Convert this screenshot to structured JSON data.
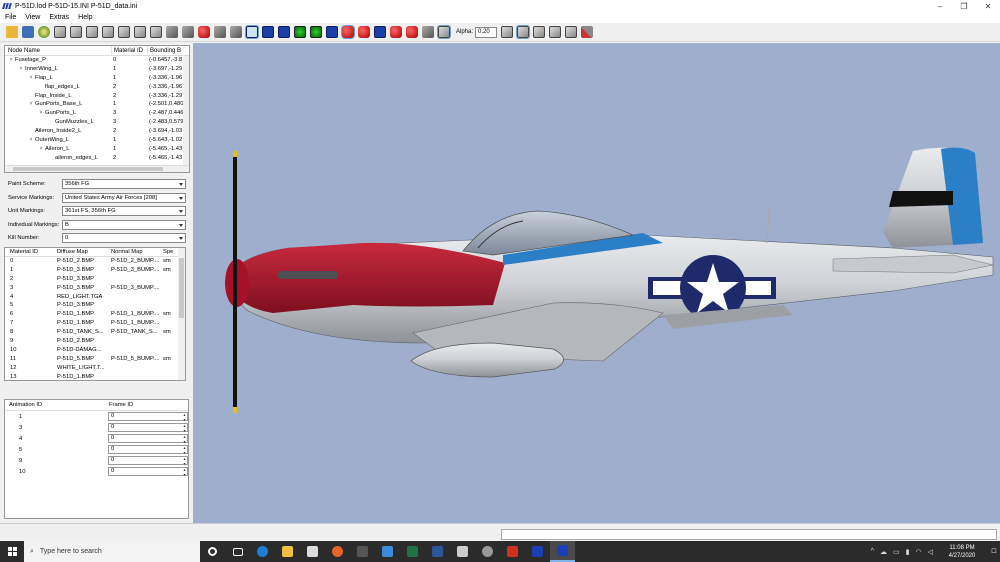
{
  "titlebar": {
    "title": "P-51D.lod  P-51D-15.INI  P-51D_data.ini",
    "minimize": "–",
    "maximize": "❐",
    "close": "✕"
  },
  "menu": [
    "File",
    "View",
    "Extras",
    "Help"
  ],
  "toolbar": {
    "alpha_label": "Alpha:",
    "alpha_value": "0.20"
  },
  "node_tree": {
    "headers": [
      "Node Name",
      "Material ID",
      "Bounding B"
    ],
    "rows": [
      {
        "indent": 0,
        "expand": "v",
        "name": "Fuselage_P",
        "mat": "0",
        "bounds": "(-0.6457,-3.8"
      },
      {
        "indent": 1,
        "expand": "v",
        "name": "InnerWing_L",
        "mat": "1",
        "bounds": "(-3.697,-1.29"
      },
      {
        "indent": 2,
        "expand": "v",
        "name": "Flap_L",
        "mat": "1",
        "bounds": "(-3.336,-1.96"
      },
      {
        "indent": 3,
        "expand": "",
        "name": "flap_edges_L",
        "mat": "2",
        "bounds": "(-3.336,-1.96"
      },
      {
        "indent": 2,
        "expand": "",
        "name": "Flap_Inside_L",
        "mat": "2",
        "bounds": "(-3.336,-1.29"
      },
      {
        "indent": 2,
        "expand": "v",
        "name": "GunPorts_Base_L",
        "mat": "1",
        "bounds": "(-2.501,0.480"
      },
      {
        "indent": 3,
        "expand": "v",
        "name": "GunPorts_L",
        "mat": "3",
        "bounds": "(-2.487,0.446"
      },
      {
        "indent": 4,
        "expand": "",
        "name": "GunMuzzles_L",
        "mat": "3",
        "bounds": "(-2.483,0.579"
      },
      {
        "indent": 2,
        "expand": "",
        "name": "Aileron_Inside2_L",
        "mat": "2",
        "bounds": "(-3.694,-1.03"
      },
      {
        "indent": 2,
        "expand": "v",
        "name": "OuterWing_L",
        "mat": "1",
        "bounds": "(-5.643,-1.02"
      },
      {
        "indent": 3,
        "expand": "v",
        "name": "Aileron_L",
        "mat": "1",
        "bounds": "(-5.465,-1.43"
      },
      {
        "indent": 4,
        "expand": "",
        "name": "aileron_edges_L",
        "mat": "2",
        "bounds": "(-5.465,-1.43"
      }
    ]
  },
  "fields": [
    {
      "label": "Paint Scheme:",
      "value": "356th FG"
    },
    {
      "label": "Service Markings:",
      "value": "United States Army Air Forces [208]"
    },
    {
      "label": "Unit Markings:",
      "value": "361st FS, 356th FG"
    },
    {
      "label": "Individual Markings:",
      "value": "B"
    },
    {
      "label": "Kill Number:",
      "value": "0"
    }
  ],
  "materials": {
    "headers": [
      "Material ID",
      "Diffuse Map",
      "Normal Map",
      "Spe"
    ],
    "rows": [
      [
        "0",
        "P-51D_2.BMP",
        "P-51D_2_BUMP....",
        "sm"
      ],
      [
        "1",
        "P-51D_3.BMP",
        "P-51D_3_BUMP....",
        "sm"
      ],
      [
        "2",
        "P-51D_3.BMP",
        "",
        ""
      ],
      [
        "3",
        "P-51D_3.BMP",
        "P-51D_3_BUMP....",
        ""
      ],
      [
        "4",
        "RED_LIGHT.TGA",
        "",
        ""
      ],
      [
        "5",
        "P-51D_3.BMP",
        "",
        ""
      ],
      [
        "6",
        "P-51D_1.BMP",
        "P-51D_1_BUMP....",
        "sm"
      ],
      [
        "7",
        "P-51D_1.BMP",
        "P-51D_1_BUMP....",
        ""
      ],
      [
        "8",
        "P-51D_TANK_S...",
        "P-51D_TANK_S...",
        "sm"
      ],
      [
        "9",
        "P-51D_2.BMP",
        "",
        ""
      ],
      [
        "10",
        "P-51D-DAMAG...",
        "",
        ""
      ],
      [
        "11",
        "P-51D_5.BMP",
        "P-51D_5_BUMP....",
        "sm"
      ],
      [
        "12",
        "WHITE_LIGHT.T...",
        "",
        ""
      ],
      [
        "13",
        "P-51D_1.BMP",
        "",
        ""
      ]
    ]
  },
  "animations": {
    "headers": [
      "Animation ID",
      "Frame ID"
    ],
    "rows": [
      [
        "1",
        "0"
      ],
      [
        "3",
        "0"
      ],
      [
        "4",
        "0"
      ],
      [
        "5",
        "0"
      ],
      [
        "9",
        "0"
      ],
      [
        "10",
        "0"
      ]
    ]
  },
  "taskbar": {
    "search_placeholder": "Type here to search",
    "time": "11:08 PM",
    "date": "4/27/2020"
  },
  "colors": {
    "viewport_bg": "#9faecc",
    "nose_red": "#b3172f",
    "tail_blue": "#2b7fc6",
    "roundel_blue": "#1f2a6b"
  }
}
